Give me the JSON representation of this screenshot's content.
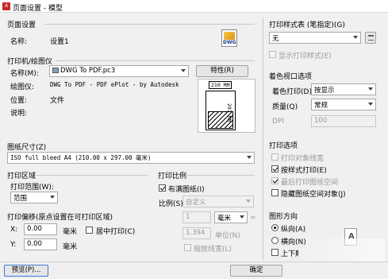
{
  "title": "页面设置 - 模型",
  "page_setup": {
    "group": "页面设置",
    "name_label": "名称:",
    "name_value": "设置1",
    "icon_label": "DWG"
  },
  "printer": {
    "group": "打印机/绘图仪",
    "name_label": "名称(M):",
    "name_value": "DWG To PDF.pc3",
    "props_button": "特性(R)",
    "plotter_label": "绘图仪:",
    "plotter_value": "DWG To PDF - PDF ePlot - by Autodesk",
    "location_label": "位置:",
    "location_value": "文件",
    "desc_label": "说明:",
    "preview_width": "210 MM",
    "preview_height": "297 MM"
  },
  "paper_size": {
    "group": "图纸尺寸(Z)",
    "value": "ISO full bleed A4 (210.00 x 297.00 毫米)"
  },
  "plot_area": {
    "group": "打印区域",
    "range_label": "打印范围(W):",
    "range_value": "范围"
  },
  "plot_offset": {
    "group": "打印偏移(原点设置在可打印区域)",
    "x_label": "X:",
    "x_value": "0.00",
    "x_unit": "毫米",
    "center_label": "居中打印(C)",
    "y_label": "Y:",
    "y_value": "0.00",
    "y_unit": "毫米"
  },
  "plot_scale": {
    "group": "打印比例",
    "fit_label": "布满图纸(I)",
    "scale_label": "比例(S):",
    "scale_value": "自定义",
    "num_value": "1",
    "num_unit": "毫米",
    "eq": "=",
    "den_value": "1.394",
    "den_unit": "单位(N)",
    "lineweights_label": "缩放线宽(L)"
  },
  "plot_style_table": {
    "group": "打印样式表 (笔指定)(G)",
    "value": "无",
    "show_label": "显示打印样式(E)"
  },
  "shaded_viewport": {
    "group": "着色视口选项",
    "shade_label": "着色打印(D)",
    "shade_value": "按显示",
    "quality_label": "质量(Q)",
    "quality_value": "常规",
    "dpi_label": "DPI",
    "dpi_value": "100"
  },
  "plot_options": {
    "group": "打印选项",
    "items": [
      {
        "label": "打印对象线宽",
        "checked": false,
        "disabled": true
      },
      {
        "label": "按样式打印(E)",
        "checked": true,
        "disabled": false
      },
      {
        "label": "最后打印图纸空间",
        "checked": true,
        "disabled": true
      },
      {
        "label": "隐藏图纸空间对象(J)",
        "checked": false,
        "disabled": false
      }
    ]
  },
  "orientation": {
    "group": "图形方向",
    "portrait": "纵向(A)",
    "landscape": "横向(N)",
    "upside": "上下颠倒打印(-)"
  },
  "footer": {
    "preview_button": "预览(P)...",
    "ok_button": "确定"
  }
}
